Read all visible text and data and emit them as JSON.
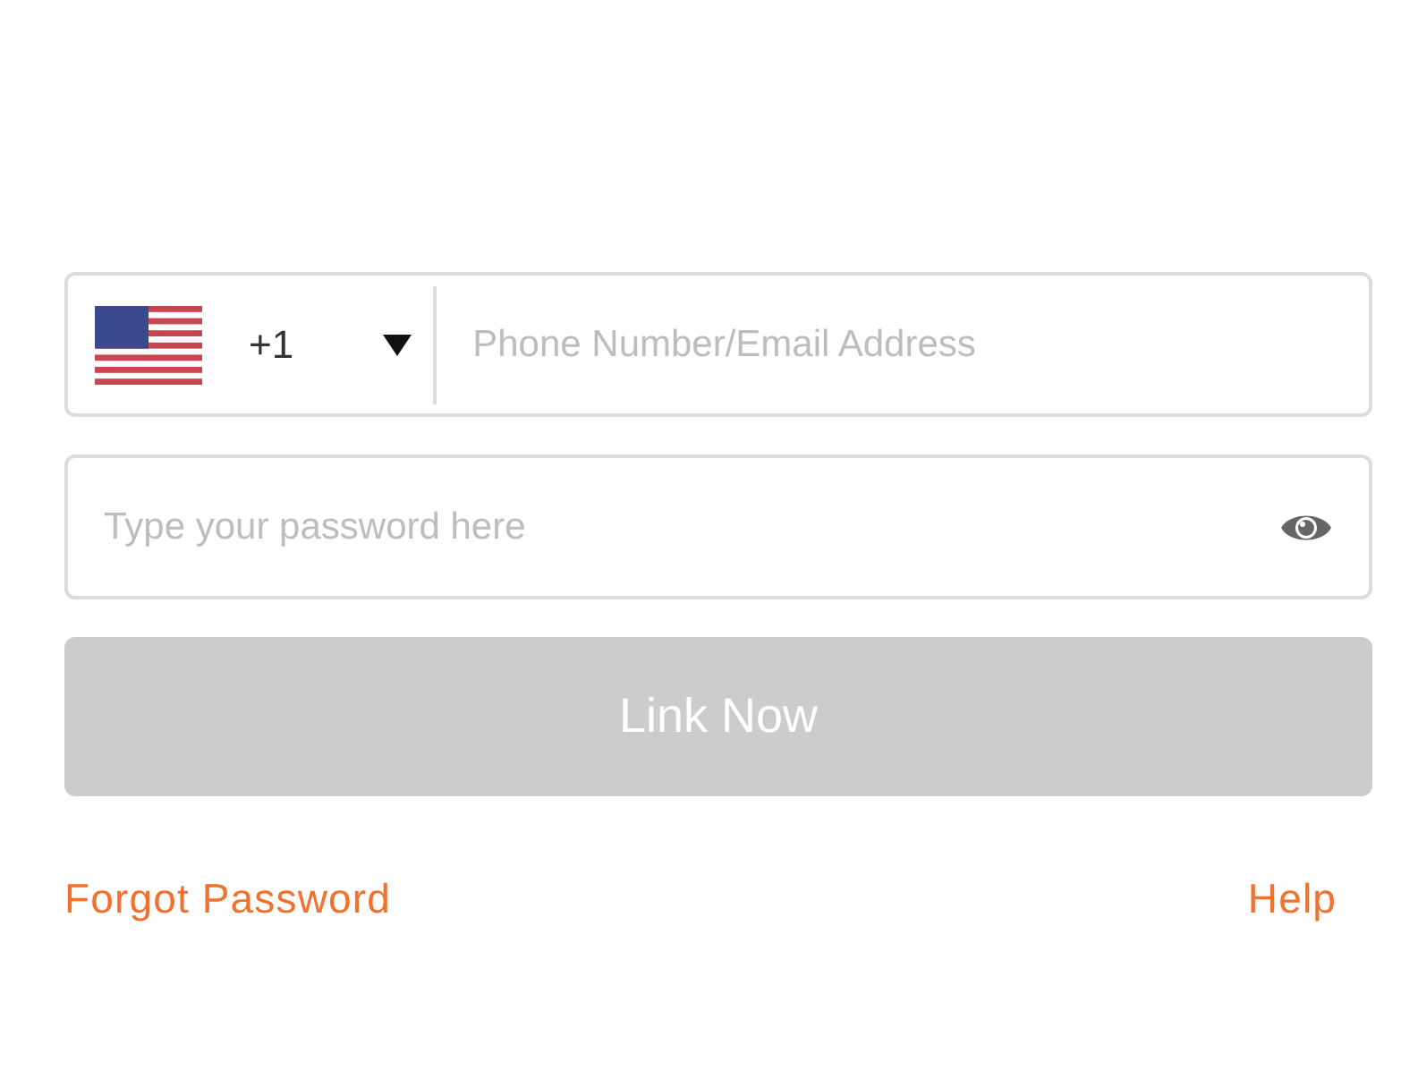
{
  "phone": {
    "country_code": "+1",
    "placeholder": "Phone Number/Email Address"
  },
  "password": {
    "placeholder": "Type your password here"
  },
  "link_button": {
    "label": "Link Now",
    "disabled": true
  },
  "links": [
    {
      "label": "Forgot Password"
    },
    {
      "label": "Help"
    }
  ]
}
